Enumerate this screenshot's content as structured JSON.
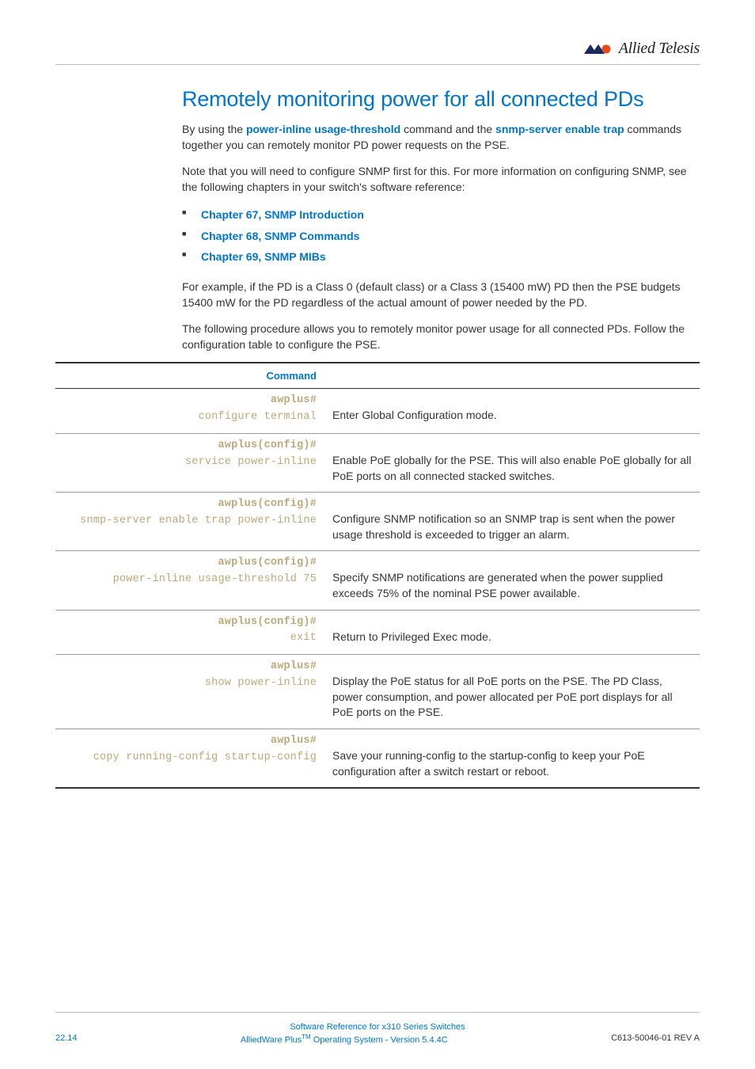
{
  "logo": {
    "brand": "Allied Telesis"
  },
  "heading": "Remotely monitoring power for all connected PDs",
  "intro": {
    "p1_a": "By using the ",
    "p1_cmd1": "power-inline usage-threshold",
    "p1_b": " command and the ",
    "p1_cmd2": "snmp-server enable trap",
    "p1_c": " commands together you can remotely monitor PD power requests on the PSE.",
    "p2": "Note that you will need to configure SNMP first for this. For more information on configuring SNMP, see the following chapters in your switch's software reference:"
  },
  "bullets": [
    "Chapter 67, SNMP Introduction",
    "Chapter 68, SNMP Commands",
    "Chapter 69, SNMP MIBs"
  ],
  "after_bullets": {
    "p1": "For example, if the PD is a Class 0 (default class) or a Class 3 (15400 mW) PD then the PSE budgets 15400 mW for the PD regardless of the actual amount of power needed by the PD.",
    "p2": "The following procedure allows you to remotely monitor power usage for all connected PDs. Follow the configuration table to configure the PSE."
  },
  "table": {
    "header_left": "Command",
    "header_right": "",
    "rows": [
      {
        "prompt": "awplus#",
        "cmd": "configure terminal",
        "desc": "Enter Global Configuration mode."
      },
      {
        "prompt": "awplus(config)#",
        "cmd": "service power-inline",
        "desc": "Enable PoE globally for the PSE. This will also enable PoE globally for all PoE ports on all connected stacked switches."
      },
      {
        "prompt": "awplus(config)#",
        "cmd": "snmp-server enable trap power-inline",
        "desc": "Configure SNMP notification so an SNMP trap is sent when the power usage threshold is exceeded to trigger an alarm."
      },
      {
        "prompt": "awplus(config)#",
        "cmd": "power-inline usage-threshold 75",
        "desc": "Specify SNMP notifications are generated when the power supplied exceeds 75% of the nominal PSE power available."
      },
      {
        "prompt": "awplus(config)#",
        "cmd": "exit",
        "desc": "Return to Privileged Exec mode."
      },
      {
        "prompt": "awplus#",
        "cmd": "show power-inline",
        "desc": "Display the PoE status for all PoE ports on the PSE. The PD Class, power consumption, and power allocated per PoE port displays for all PoE ports on the PSE."
      },
      {
        "prompt": "awplus#",
        "cmd": "copy running-config startup-config",
        "desc": "Save your running-config to the startup-config to keep your PoE configuration after a switch restart or reboot."
      }
    ]
  },
  "footer": {
    "line1": "Software Reference for x310 Series Switches",
    "left": "22.14",
    "center_a": "AlliedWare Plus",
    "center_b": " Operating System  - Version 5.4.4C",
    "right": "C613-50046-01 REV A"
  }
}
